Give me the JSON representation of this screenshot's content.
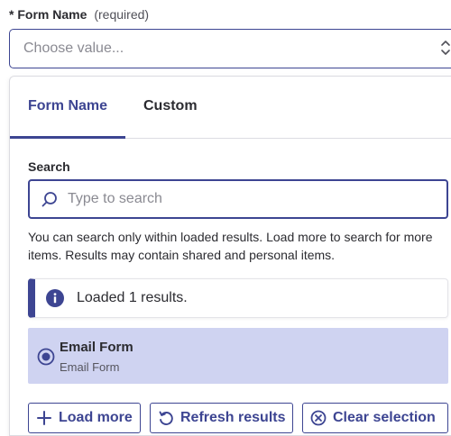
{
  "field": {
    "label": "* Form Name",
    "required_hint": "(required)",
    "placeholder": "Choose value..."
  },
  "tabs": [
    {
      "label": "Form Name",
      "active": true
    },
    {
      "label": "Custom",
      "active": false
    }
  ],
  "search": {
    "label": "Search",
    "placeholder": "Type to search",
    "value": "",
    "help": "You can search only within loaded results. Load more to search for more items. Results may contain shared and personal items."
  },
  "alert": {
    "text": "Loaded 1 results.",
    "icon": "info-icon"
  },
  "options": [
    {
      "title": "Email Form",
      "subtitle": "Email Form",
      "selected": true
    }
  ],
  "buttons": {
    "load_more": "Load more",
    "refresh": "Refresh results",
    "clear": "Clear selection"
  },
  "colors": {
    "accent": "#3d4592",
    "selected_bg": "#cfd3f1",
    "border": "#dcdce2",
    "text": "#2b2b30",
    "muted": "#8a8a92"
  }
}
